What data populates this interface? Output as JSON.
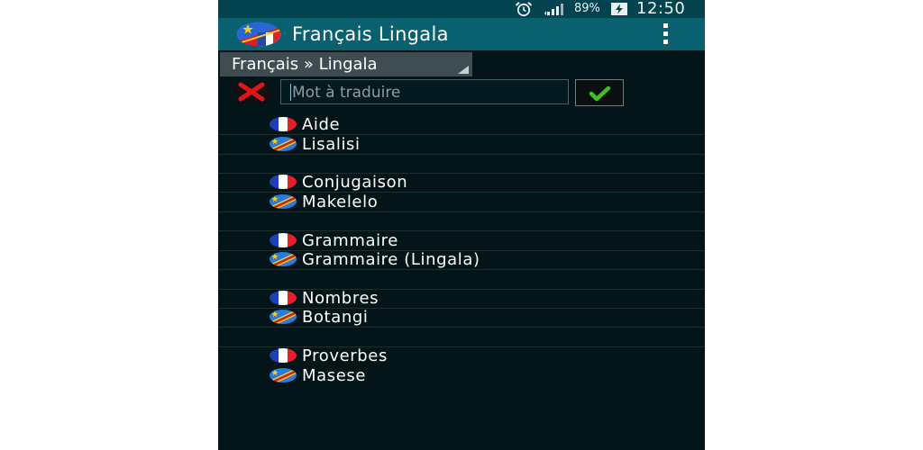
{
  "status_bar": {
    "battery_percent": "89%",
    "time": "12:50",
    "icons": [
      "alarm-icon",
      "signal-icon",
      "battery-charging-icon"
    ]
  },
  "action_bar": {
    "title": "Français Lingala",
    "icon": "congo-flag-app-icon",
    "menu_icon": "overflow-menu-icon"
  },
  "direction": {
    "label": "Français » Lingala"
  },
  "search": {
    "value": "",
    "placeholder": "Mot à traduire",
    "clear_icon": "red-x-icon",
    "ok_icon": "green-check-icon"
  },
  "topics": [
    {
      "fr": "Aide",
      "ln": "Lisalisi"
    },
    {
      "fr": "Conjugaison",
      "ln": "Makelelo"
    },
    {
      "fr": "Grammaire",
      "ln": "Grammaire (Lingala)"
    },
    {
      "fr": "Nombres",
      "ln": "Botangi"
    },
    {
      "fr": "Proverbes",
      "ln": "Masese"
    }
  ],
  "colors": {
    "status_bar": "#03434f",
    "action_bar": "#09606f",
    "background": "#041519",
    "spinner": "#3f4c52",
    "clear_x": "#e0151b",
    "check": "#3ec21d"
  }
}
